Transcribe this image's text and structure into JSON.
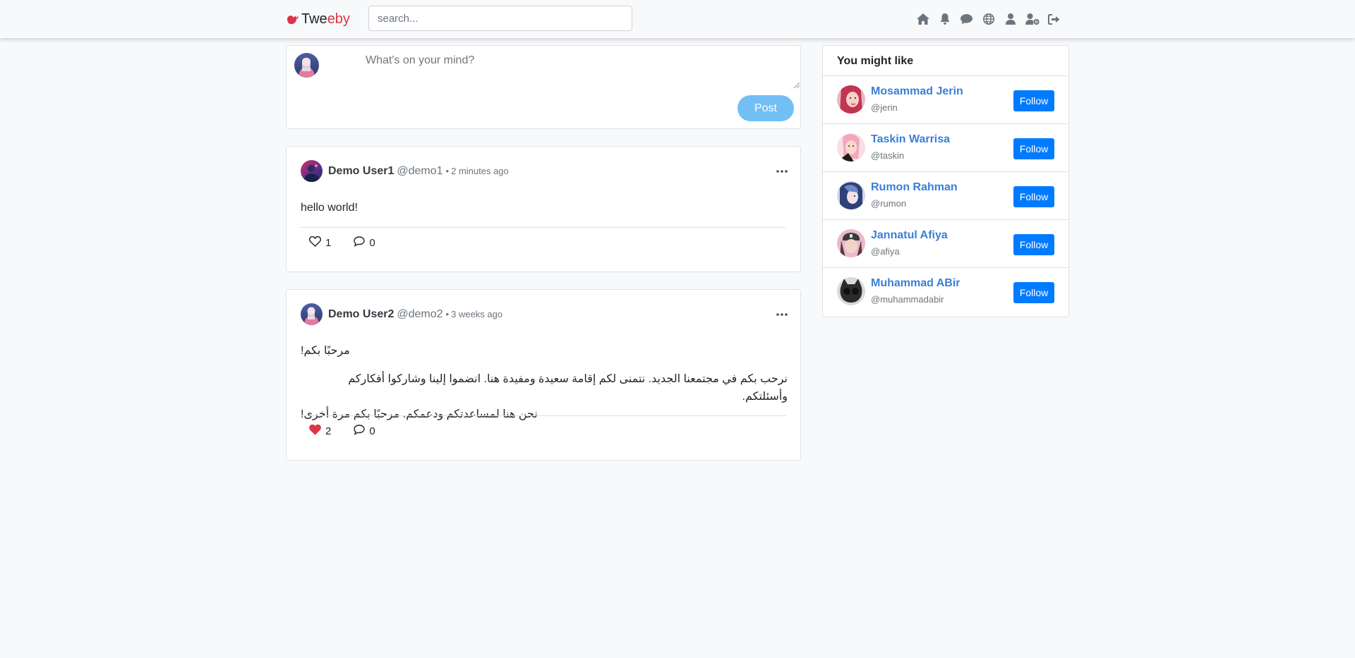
{
  "navbar": {
    "brand_part1": "Twe",
    "brand_part2": "eby",
    "search_placeholder": "search...",
    "icons": [
      "home-icon",
      "bell-icon",
      "messages-icon",
      "globe-icon",
      "user-icon",
      "user-settings-icon",
      "sign-out-icon"
    ]
  },
  "composer": {
    "placeholder": "What's on your mind?",
    "post_label": "Post"
  },
  "posts": [
    {
      "name": "Demo User1",
      "handle": "@demo1",
      "dot": "•",
      "time": "2 minutes ago",
      "text": "hello world!",
      "likes": "1",
      "liked": false,
      "comments": "0"
    },
    {
      "name": "Demo User2",
      "handle": "@demo2",
      "dot": "•",
      "time": "3 weeks ago",
      "text_line1": "مرحبًا بكم!",
      "text_line2": "نرحب بكم في مجتمعنا الجديد. نتمنى لكم إقامة سعيدة ومفيدة هنا. انضموا إلينا وشاركوا أفكاركم وأسئلتكم.",
      "text_line3": "نحن هنا لمساعدتكم ودعمكم. مرحبًا بكم مرة أخرى!",
      "likes": "2",
      "liked": true,
      "comments": "0"
    }
  ],
  "sidebar": {
    "title": "You might like",
    "follow_label": "Follow",
    "users": [
      {
        "name": "Mosammad Jerin",
        "handle": "@jerin"
      },
      {
        "name": "Taskin Warrisa",
        "handle": "@taskin"
      },
      {
        "name": "Rumon Rahman",
        "handle": "@rumon"
      },
      {
        "name": "Jannatul Afiya",
        "handle": "@afiya"
      },
      {
        "name": "Muhammad ABir",
        "handle": "@muhammadabir"
      }
    ]
  },
  "colors": {
    "brand_red": "#dc3545",
    "link_blue": "#3a7fd6",
    "follow_blue": "#007bff",
    "post_button": "#72bff4",
    "like_red": "#dc3545"
  }
}
